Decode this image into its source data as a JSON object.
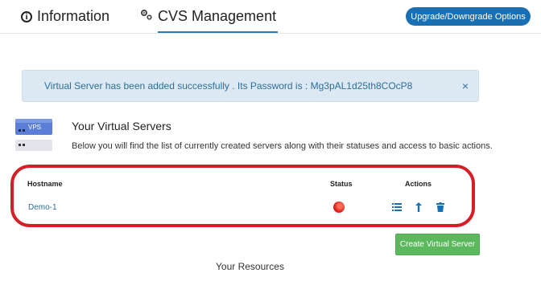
{
  "tabs": [
    {
      "label": "Information",
      "icon": "info-icon"
    },
    {
      "label": "CVS Management",
      "icon": "gears-icon",
      "active": true
    }
  ],
  "upgrade_button": "Upgrade/Downgrade Options",
  "alert": {
    "text": "Virtual Server has been added successfully . Its Password is : Mg3pAL1d25th8COcP8",
    "close": "×"
  },
  "vps_icon_label": "VPS",
  "section": {
    "title": "Your Virtual Servers",
    "description": "Below you will find the list of currently created servers along with their statuses and access to basic actions."
  },
  "table": {
    "headers": {
      "hostname": "Hostname",
      "status": "Status",
      "actions": "Actions"
    },
    "rows": [
      {
        "hostname": "Demo-1",
        "status": "stopped",
        "status_color": "#e0261c",
        "actions": [
          "list-icon",
          "upload-arrow-icon",
          "trash-icon"
        ]
      }
    ]
  },
  "create_button": "Create Virtual Server",
  "resources_title": "Your Resources",
  "colors": {
    "accent": "#1a6fb3",
    "success": "#5cb85c",
    "alert_bg": "#dce8f2",
    "highlight_outline": "#d41f26"
  }
}
